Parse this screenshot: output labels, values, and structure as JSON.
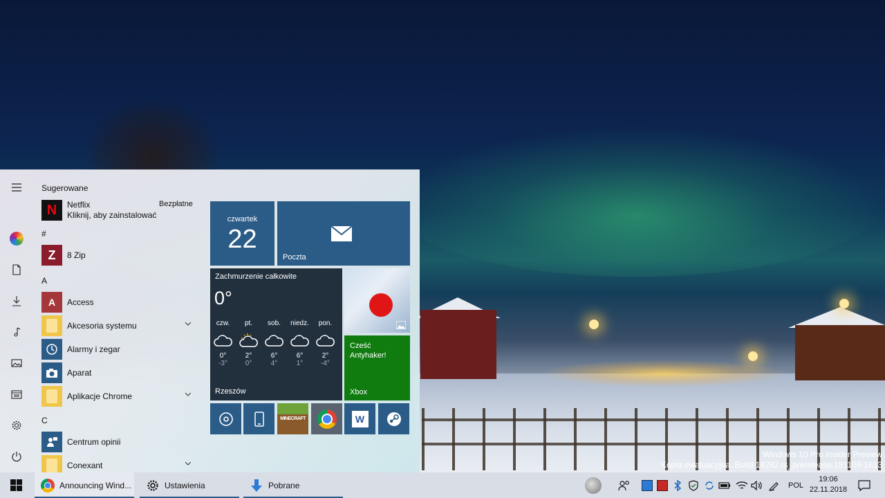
{
  "wallpaper": {
    "watermark_line1": "Windows 10 Pro Insider Preview",
    "watermark_line2": "Kopia ewaluacyjna. Build 18282.rs_prerelease.181109-1613"
  },
  "start_menu": {
    "rail": [
      "hamburger-icon",
      "user-avatar",
      "documents-icon",
      "downloads-icon",
      "music-icon",
      "pictures-icon",
      "file-explorer-icon",
      "settings-icon",
      "power-icon"
    ],
    "suggested_header": "Sugerowane",
    "suggested_app": {
      "name": "Netflix",
      "subtitle": "Kliknij, aby zainstalować",
      "badge": "Bezpłatne"
    },
    "sections": {
      "hash": "#",
      "a": "A",
      "c": "C"
    },
    "apps": {
      "zip": "8 Zip",
      "access": "Access",
      "accessories": "Akcesoria systemu",
      "alarms": "Alarmy i zegar",
      "camera": "Aparat",
      "chrome_apps": "Aplikacje Chrome",
      "feedback": "Centrum opinii",
      "conexant": "Conexant"
    },
    "tiles": {
      "date_day": "czwartek",
      "date_num": "22",
      "mail_label": "Poczta",
      "weather": {
        "condition": "Zachmurzenie całkowite",
        "temp": "0°",
        "city": "Rzeszów",
        "days": [
          {
            "name": "czw.",
            "icon": "cloud-icon",
            "hi": "0°",
            "lo": "-3°"
          },
          {
            "name": "pt.",
            "icon": "sun-cloud-icon",
            "hi": "2°",
            "lo": "0°"
          },
          {
            "name": "sob.",
            "icon": "cloud-icon",
            "hi": "6°",
            "lo": "4°"
          },
          {
            "name": "niedz.",
            "icon": "cloud-icon",
            "hi": "6°",
            "lo": "1°"
          },
          {
            "name": "pon.",
            "icon": "cloud-icon",
            "hi": "2°",
            "lo": "-4°"
          }
        ]
      },
      "xbox_message": "Cześć Antyhaker!",
      "xbox_label": "Xbox",
      "small": [
        "groove-icon",
        "phone-icon",
        "minecraft-icon",
        "chrome-icon",
        "word-icon",
        "steam-icon"
      ]
    }
  },
  "taskbar": {
    "apps": [
      {
        "label": "Announcing Wind...",
        "icon": "chrome-icon"
      },
      {
        "label": "Ustawienia",
        "icon": "gear-icon"
      },
      {
        "label": "Pobrane",
        "icon": "download-arrow-icon"
      }
    ],
    "language": "POL",
    "time": "19:06",
    "date": "22.11.2018"
  },
  "colors": {
    "tile_blue": "#2b5c88",
    "tile_dark": "#22303e",
    "xbox_green": "#107c10",
    "taskbar": "#d9dde6"
  }
}
